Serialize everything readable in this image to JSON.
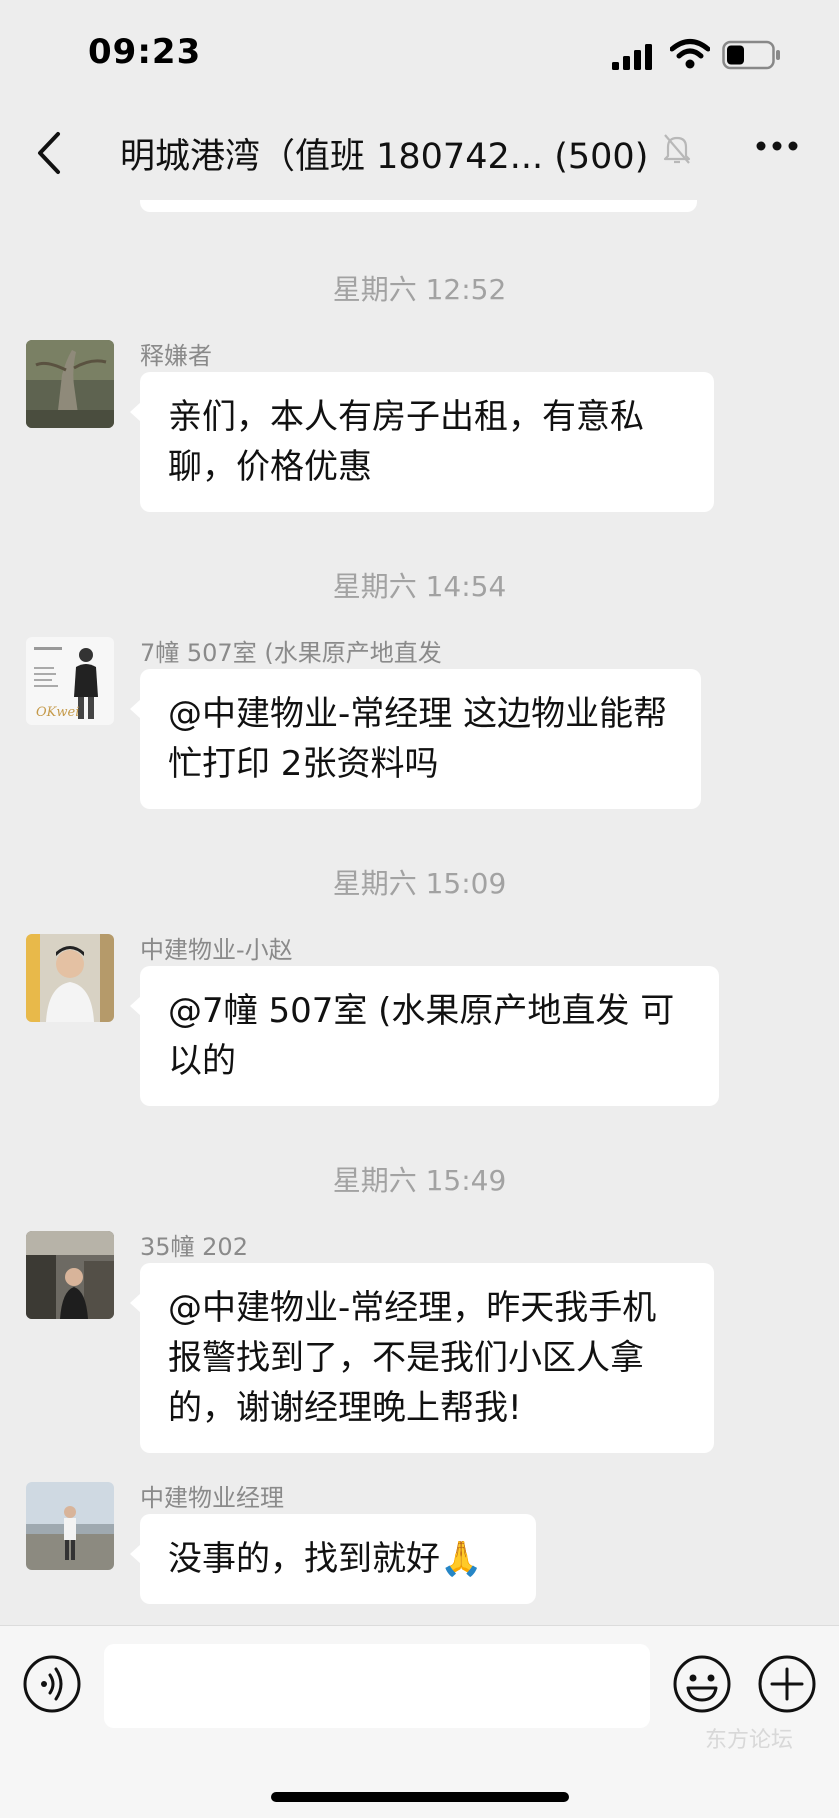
{
  "status_bar": {
    "time": "09:23"
  },
  "header": {
    "title": "明城港湾（值班 180742...  (500)"
  },
  "messages": [
    {
      "timestamp": "星期六 12:52",
      "sender": "释嫌者",
      "text": "亲们，本人有房子出租，有意私聊，价格优惠"
    },
    {
      "timestamp": "星期六 14:54",
      "sender": "7幢 507室 (水果原产地直发",
      "text": "@中建物业-常经理 这边物业能帮忙打印 2张资料吗"
    },
    {
      "timestamp": "星期六 15:09",
      "sender": "中建物业-小赵",
      "text": "@7幢 507室 (水果原产地直发 可以的"
    },
    {
      "timestamp": "星期六 15:49",
      "sender": "35幢 202",
      "text": "@中建物业-常经理，昨天我手机报警找到了，不是我们小区人拿的，谢谢经理晚上帮我!"
    },
    {
      "timestamp": "",
      "sender": "中建物业经理",
      "text": "没事的，找到就好🙏"
    }
  ],
  "avatar1_caption": "OKwei",
  "watermark": "东方论坛",
  "icons": {
    "back": "chevron-left-icon",
    "mute": "bell-muted-icon",
    "more": "more-icon",
    "voice": "voice-icon",
    "emoji": "emoji-icon",
    "plus": "plus-icon"
  }
}
